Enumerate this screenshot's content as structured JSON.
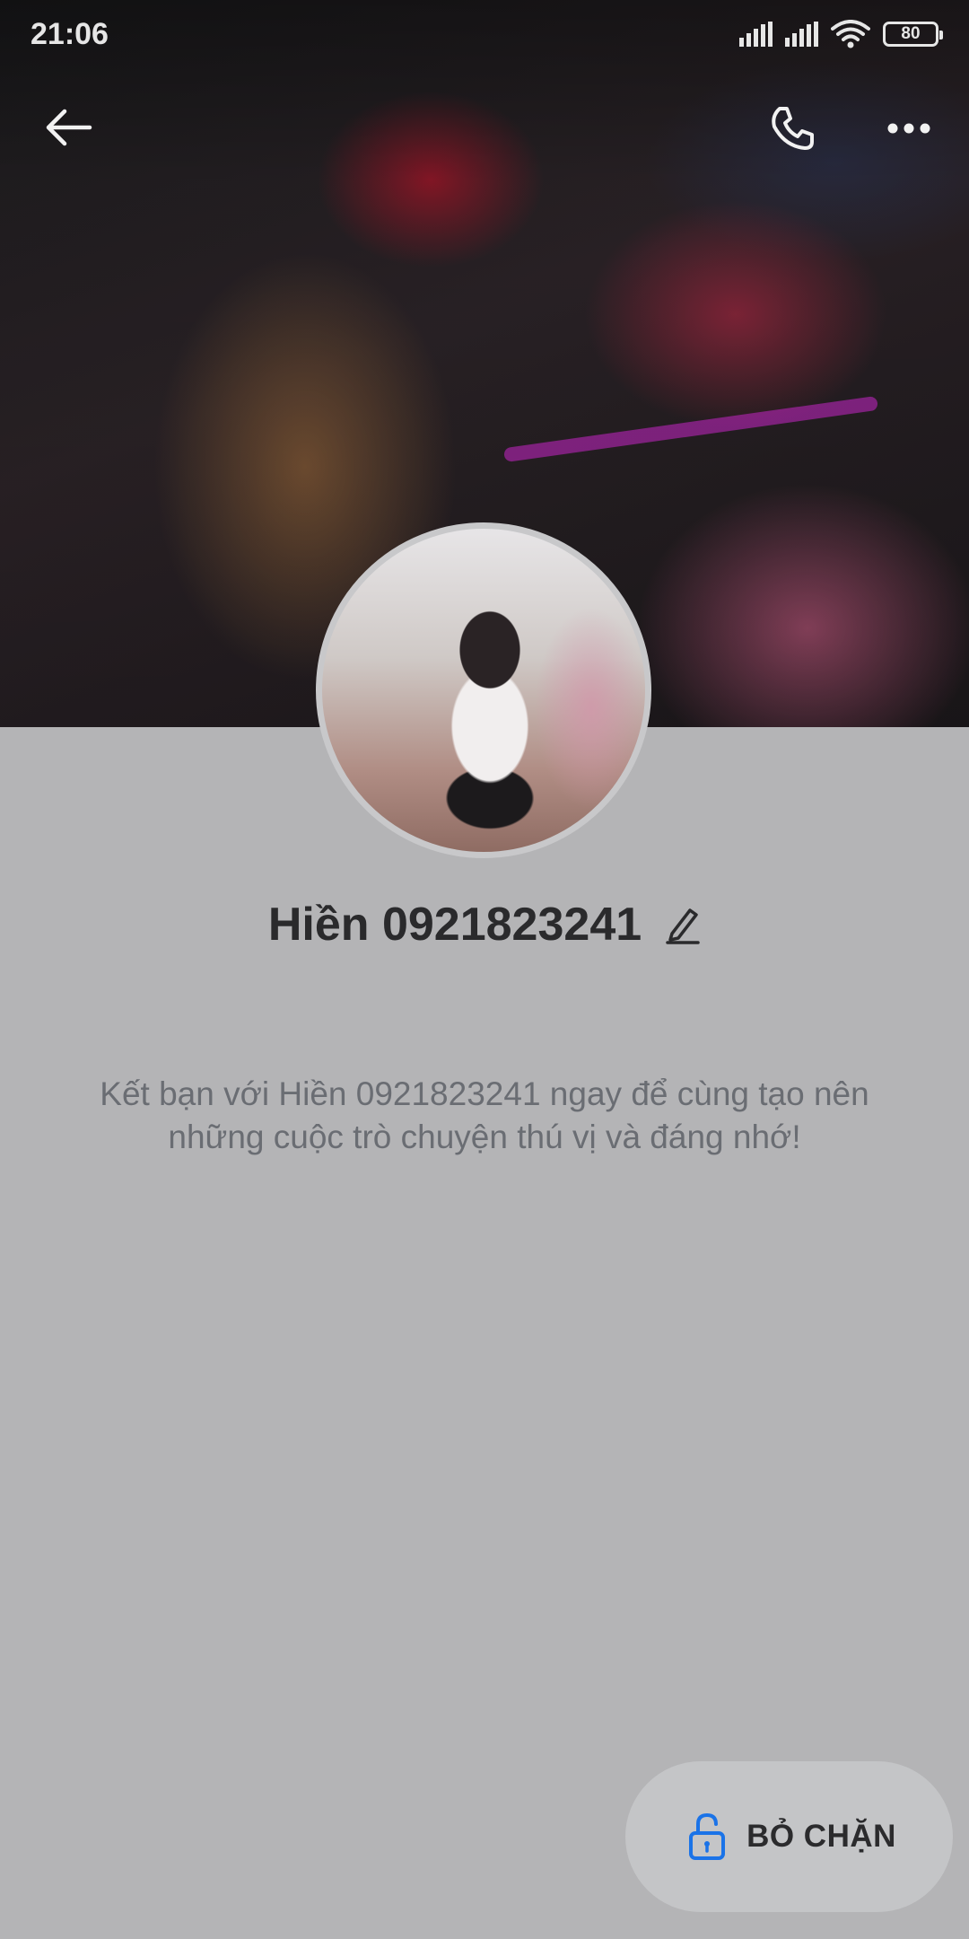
{
  "status_bar": {
    "time": "21:06",
    "battery": "80",
    "icons": [
      "signal-icon",
      "signal-icon",
      "wifi-icon",
      "battery-icon"
    ]
  },
  "header": {
    "back_icon": "arrow-left-icon",
    "call_icon": "phone-icon",
    "more_icon": "more-dots-icon"
  },
  "profile": {
    "name": "Hiền 0921823241",
    "edit_icon": "pencil-icon",
    "friend_message": "Kết bạn với Hiền 0921823241 ngay để cùng tạo nên những cuộc trò chuyện thú vị và đáng nhớ!"
  },
  "actions": {
    "unblock_label": "BỎ CHẶN",
    "unblock_icon": "unlock-icon",
    "accent_color": "#1a73e8"
  }
}
